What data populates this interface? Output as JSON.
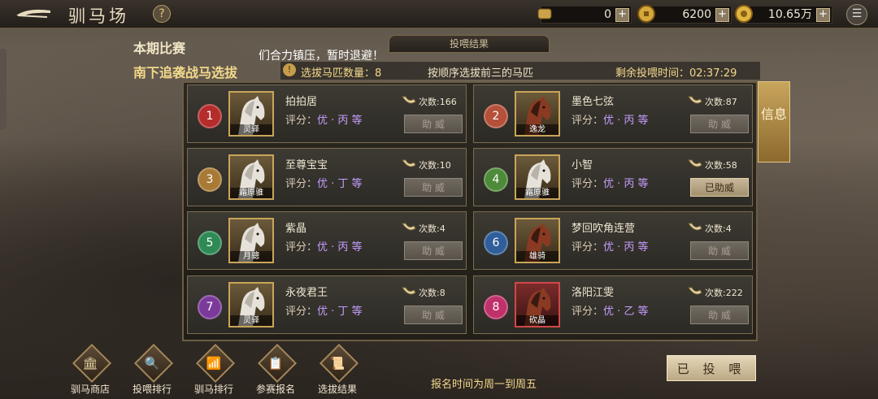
{
  "header": {
    "title": "驯马场",
    "help_icon": "?",
    "resources": [
      {
        "icon": "scroll-icon",
        "value": "0"
      },
      {
        "icon": "gold-coin-icon",
        "value": "6200"
      },
      {
        "icon": "copper-coin-icon",
        "value": "10.65万"
      }
    ],
    "plus": "+",
    "menu_icon": "☰"
  },
  "competition": {
    "period_label": "本期比赛",
    "event_name": "南下追袭战马选拔",
    "toast": "们合力镇压，暂时退避！",
    "results_tab": "投喂结果",
    "selected_count": "选拔马匹数量：8",
    "rule": "按顺序选拔前三的马匹",
    "remaining": "剩余投喂时间：02:37:29"
  },
  "horses": [
    {
      "rank": "1",
      "name": "拍拍居",
      "tag": "灵驿",
      "score_label": "评分：",
      "grade": "优 · 丙 等",
      "times": "次数:166",
      "action": "助 威",
      "rank_color": "#b52c2c",
      "portrait": "white"
    },
    {
      "rank": "2",
      "name": "墨色七弦",
      "tag": "逸龙",
      "score_label": "评分：",
      "grade": "优 · 丙 等",
      "times": "次数:87",
      "action": "助 威",
      "rank_color": "#b5503a",
      "portrait": "red"
    },
    {
      "rank": "3",
      "name": "至尊宝宝",
      "tag": "霜原骓",
      "score_label": "评分：",
      "grade": "优 · 丁 等",
      "times": "次数:10",
      "action": "助 威",
      "rank_color": "#a87a36",
      "portrait": "white"
    },
    {
      "rank": "4",
      "name": "小智",
      "tag": "霜原骓",
      "score_label": "评分：",
      "grade": "优 · 丙 等",
      "times": "次数:58",
      "action": "已助威",
      "rank_color": "#4d8a3a",
      "portrait": "white"
    },
    {
      "rank": "5",
      "name": "紫晶",
      "tag": "月骢",
      "score_label": "评分：",
      "grade": "优 · 丙 等",
      "times": "次数:4",
      "action": "助 威",
      "rank_color": "#2f8a55",
      "portrait": "white"
    },
    {
      "rank": "6",
      "name": "梦回吹角连营",
      "tag": "雄骑",
      "score_label": "评分：",
      "grade": "优 · 丙 等",
      "times": "次数:4",
      "action": "助 威",
      "rank_color": "#2f5e9a",
      "portrait": "red"
    },
    {
      "rank": "7",
      "name": "永夜君王",
      "tag": "灵驿",
      "score_label": "评分：",
      "grade": "优 · 丁 等",
      "times": "次数:8",
      "action": "助 威",
      "rank_color": "#7a3a9a",
      "portrait": "white"
    },
    {
      "rank": "8",
      "name": "洛阳江雯",
      "tag": "砍晶",
      "score_label": "评分：",
      "grade": "优 · 乙 等",
      "times": "次数:222",
      "action": "助 威",
      "rank_color": "#c0306a",
      "portrait": "red-border"
    }
  ],
  "side_tab": "信息",
  "bottom": {
    "buttons": [
      {
        "icon": "shop-icon",
        "glyph": "🏛",
        "label": "驯马商店"
      },
      {
        "icon": "search-rank-icon",
        "glyph": "🔍",
        "label": "投喂排行"
      },
      {
        "icon": "bar-chart-icon",
        "glyph": "📶",
        "label": "驯马排行"
      },
      {
        "icon": "signup-icon",
        "glyph": "📋",
        "label": "参赛报名"
      },
      {
        "icon": "result-icon",
        "glyph": "📜",
        "label": "选拔结果"
      }
    ],
    "signup_time": "报名时间为周一到周五",
    "fed_button": "已 投 喂"
  }
}
